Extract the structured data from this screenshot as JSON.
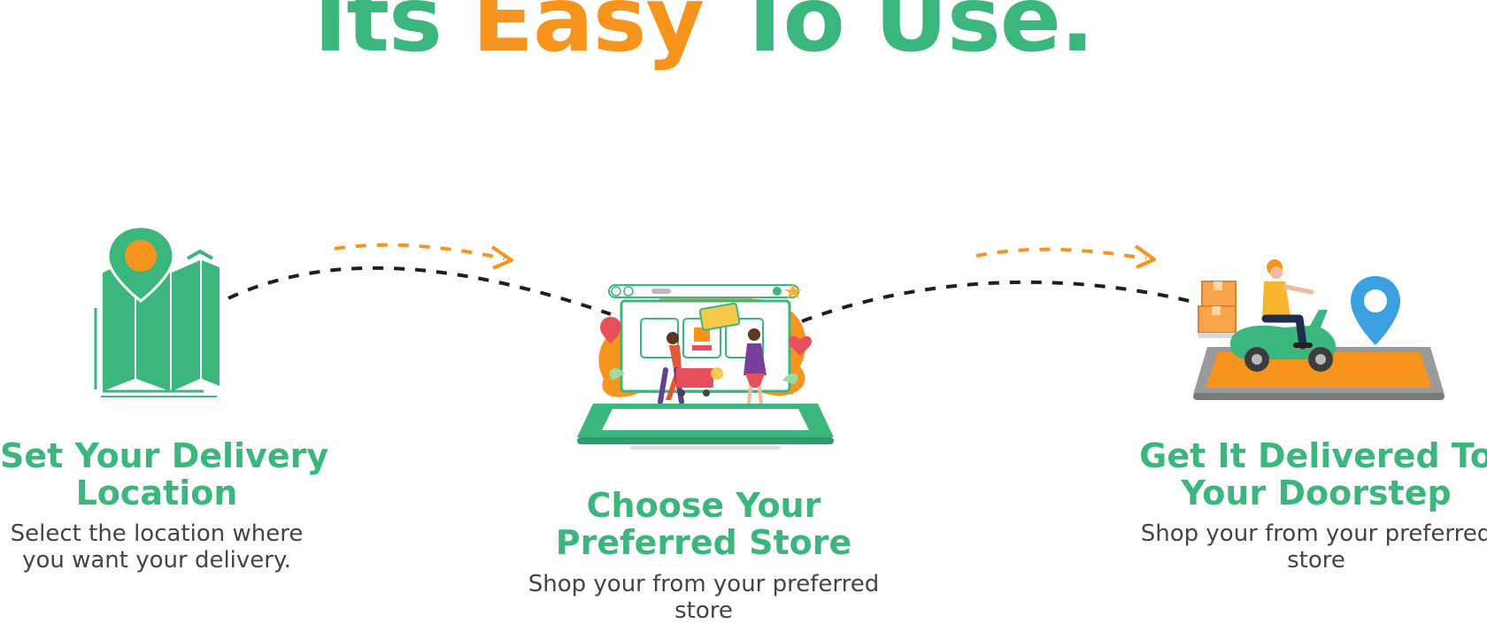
{
  "title": {
    "prefix": "Its ",
    "accent": "Easy",
    "suffix": " To Use."
  },
  "colors": {
    "green": "#3bb77e",
    "orange": "#f7941d",
    "dark": "#1f1f1f",
    "text": "#444444"
  },
  "steps": [
    {
      "heading": [
        "Set Your Delivery",
        "Location"
      ],
      "description": [
        "Select the location where",
        "you want your delivery."
      ],
      "icon": "map-pin-icon"
    },
    {
      "heading": [
        "Choose Your",
        "Preferred Store"
      ],
      "description": [
        "Shop your from your preferred",
        "store"
      ],
      "icon": "online-store-laptop-icon"
    },
    {
      "heading": [
        "Get It Delivered To",
        "Your Doorstep"
      ],
      "description": [
        "Shop your from your preferred",
        "store"
      ],
      "icon": "delivery-scooter-icon"
    }
  ]
}
